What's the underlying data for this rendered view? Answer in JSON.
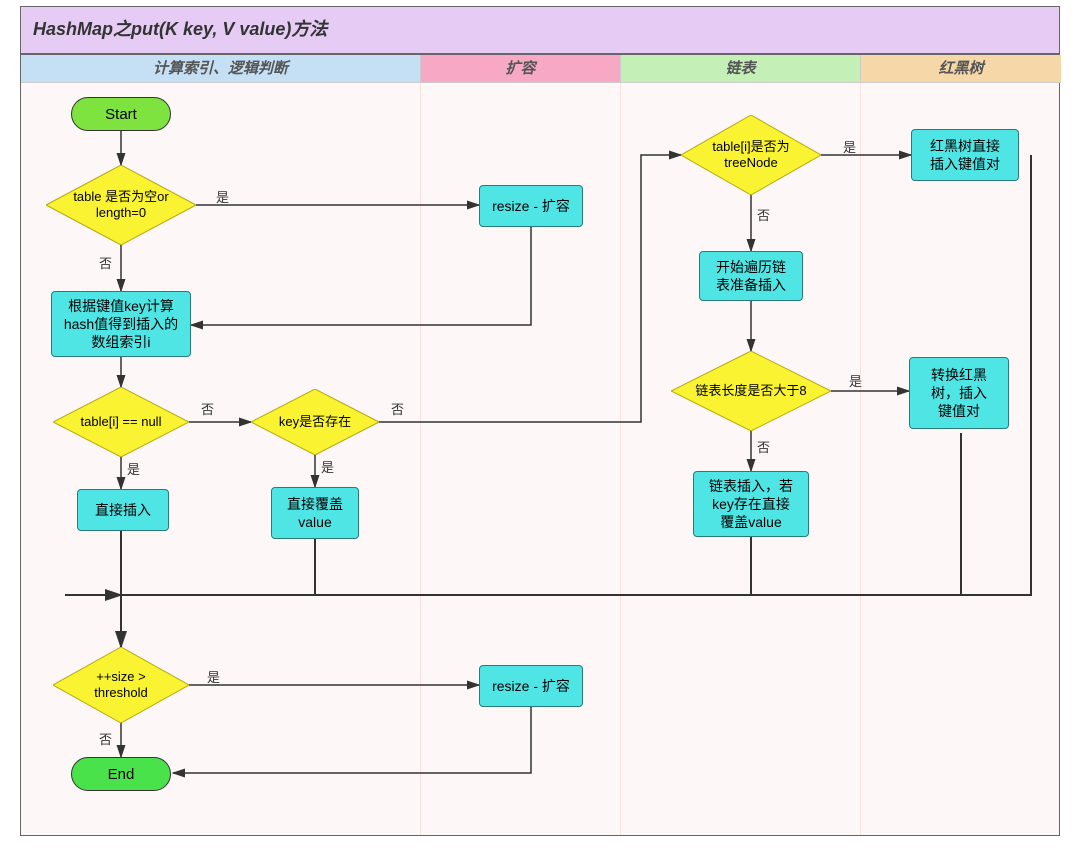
{
  "title_prefix": "HashMap之",
  "title_method": "put(K key, V value)",
  "title_suffix": "方法",
  "lanes": {
    "col1": "计算索引、逻辑判断",
    "col2": "扩容",
    "col3": "链表",
    "col4": "红黑树"
  },
  "nodes": {
    "start": "Start",
    "end": "End",
    "d_table_empty": "table 是否为空or\nlength=0",
    "d_table_i_null": "table[i] == null",
    "d_key_exists": "key是否存在",
    "d_size_threshold": "++size >\nthreshold",
    "d_treenode": "table[i]是否为\ntreeNode",
    "d_list_len8": "链表长度是否大于8",
    "p_resize1": "resize - 扩容",
    "p_resize2": "resize - 扩容",
    "p_compute_index": "根据键值key计算\nhash值得到插入的\n数组索引i",
    "p_direct_insert": "直接插入",
    "p_overwrite": "直接覆盖\nvalue",
    "p_rbtree_insert": "红黑树直接\n插入键值对",
    "p_traverse": "开始遍历链\n表准备插入",
    "p_convert_tree": "转换红黑\n树，插入\n键值对",
    "p_list_insert": "链表插入，若\nkey存在直接\n覆盖value"
  },
  "labels": {
    "yes": "是",
    "no": "否"
  },
  "chart_data": {
    "type": "flowchart",
    "title": "HashMap之put(K key, V value)方法",
    "swimlanes": [
      {
        "id": "col1",
        "label": "计算索引、逻辑判断"
      },
      {
        "id": "col2",
        "label": "扩容"
      },
      {
        "id": "col3",
        "label": "链表"
      },
      {
        "id": "col4",
        "label": "红黑树"
      }
    ],
    "nodes": [
      {
        "id": "start",
        "type": "terminal",
        "lane": "col1",
        "label": "Start"
      },
      {
        "id": "d_table_empty",
        "type": "decision",
        "lane": "col1",
        "label": "table 是否为空or length=0"
      },
      {
        "id": "p_resize1",
        "type": "process",
        "lane": "col2",
        "label": "resize - 扩容"
      },
      {
        "id": "p_compute_index",
        "type": "process",
        "lane": "col1",
        "label": "根据键值key计算hash值得到插入的数组索引i"
      },
      {
        "id": "d_table_i_null",
        "type": "decision",
        "lane": "col1",
        "label": "table[i] == null"
      },
      {
        "id": "d_key_exists",
        "type": "decision",
        "lane": "col1",
        "label": "key是否存在"
      },
      {
        "id": "d_treenode",
        "type": "decision",
        "lane": "col3",
        "label": "table[i]是否为treeNode"
      },
      {
        "id": "p_rbtree_insert",
        "type": "process",
        "lane": "col4",
        "label": "红黑树直接插入键值对"
      },
      {
        "id": "p_traverse",
        "type": "process",
        "lane": "col3",
        "label": "开始遍历链表准备插入"
      },
      {
        "id": "d_list_len8",
        "type": "decision",
        "lane": "col3",
        "label": "链表长度是否大于8"
      },
      {
        "id": "p_convert_tree",
        "type": "process",
        "lane": "col4",
        "label": "转换红黑树，插入键值对"
      },
      {
        "id": "p_list_insert",
        "type": "process",
        "lane": "col3",
        "label": "链表插入，若key存在直接覆盖value"
      },
      {
        "id": "p_direct_insert",
        "type": "process",
        "lane": "col1",
        "label": "直接插入"
      },
      {
        "id": "p_overwrite",
        "type": "process",
        "lane": "col1",
        "label": "直接覆盖value"
      },
      {
        "id": "d_size_threshold",
        "type": "decision",
        "lane": "col1",
        "label": "++size > threshold"
      },
      {
        "id": "p_resize2",
        "type": "process",
        "lane": "col2",
        "label": "resize - 扩容"
      },
      {
        "id": "end",
        "type": "terminal",
        "lane": "col1",
        "label": "End"
      }
    ],
    "edges": [
      {
        "from": "start",
        "to": "d_table_empty"
      },
      {
        "from": "d_table_empty",
        "to": "p_resize1",
        "label": "是"
      },
      {
        "from": "d_table_empty",
        "to": "p_compute_index",
        "label": "否"
      },
      {
        "from": "p_resize1",
        "to": "p_compute_index"
      },
      {
        "from": "p_compute_index",
        "to": "d_table_i_null"
      },
      {
        "from": "d_table_i_null",
        "to": "p_direct_insert",
        "label": "是"
      },
      {
        "from": "d_table_i_null",
        "to": "d_key_exists",
        "label": "否"
      },
      {
        "from": "d_key_exists",
        "to": "p_overwrite",
        "label": "是"
      },
      {
        "from": "d_key_exists",
        "to": "d_treenode",
        "label": "否"
      },
      {
        "from": "d_treenode",
        "to": "p_rbtree_insert",
        "label": "是"
      },
      {
        "from": "d_treenode",
        "to": "p_traverse",
        "label": "否"
      },
      {
        "from": "p_traverse",
        "to": "d_list_len8"
      },
      {
        "from": "d_list_len8",
        "to": "p_convert_tree",
        "label": "是"
      },
      {
        "from": "d_list_len8",
        "to": "p_list_insert",
        "label": "否"
      },
      {
        "from": "p_direct_insert",
        "to": "d_size_threshold"
      },
      {
        "from": "p_overwrite",
        "to": "d_size_threshold"
      },
      {
        "from": "p_list_insert",
        "to": "d_size_threshold"
      },
      {
        "from": "p_convert_tree",
        "to": "d_size_threshold"
      },
      {
        "from": "p_rbtree_insert",
        "to": "d_size_threshold"
      },
      {
        "from": "d_size_threshold",
        "to": "p_resize2",
        "label": "是"
      },
      {
        "from": "d_size_threshold",
        "to": "end",
        "label": "否"
      },
      {
        "from": "p_resize2",
        "to": "end"
      }
    ]
  }
}
